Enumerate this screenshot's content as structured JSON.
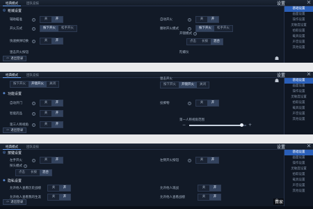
{
  "tabs": [
    "经典模式",
    "团队竞技"
  ],
  "settings_title": "设置",
  "rail": {
    "p1": [
      "基础设置",
      "画面设置",
      "操作设置",
      "灵敏度设置",
      "拾取设置",
      "载具设置",
      "声音设置",
      "其他设置"
    ],
    "p2": [
      "基础设置",
      "画面设置",
      "操作设置",
      "灵敏度设置",
      "拾取设置",
      "载具设置",
      "声音设置",
      "其他设置"
    ],
    "p3": [
      "基础设置",
      "画面设置",
      "操作设置",
      "灵敏度设置",
      "拾取设置",
      "载具设置",
      "声音设置",
      "其他设置"
    ]
  },
  "panel1": {
    "section": "枪械设置",
    "rows": [
      {
        "label": "辅助瞄准",
        "options": [
          "关",
          "开"
        ],
        "selected": 1
      },
      {
        "label": "自动开火",
        "options": [
          "关",
          "开"
        ],
        "selected": 1
      },
      {
        "label": "开火方式",
        "options": [
          "按下开火",
          "松手开火"
        ],
        "selected": 0
      },
      {
        "label": "腰射开火模式",
        "options": [
          "按下开火",
          "松手开火"
        ],
        "selected": 0
      },
      {
        "label": "快速换弹切换",
        "options": [
          "关",
          "开"
        ],
        "selected": 1
      },
      {
        "label": "开镜模式",
        "options": [
          "点击",
          "长按",
          "混合"
        ],
        "selected": 2
      }
    ],
    "truncated_left": "狙击开火按钮",
    "truncated_right": "陀螺仪"
  },
  "panel2": {
    "top_left_options": [
      "按下开火",
      "开镜开火",
      "关闭"
    ],
    "top_right_options": [
      "按下开火",
      "开镜开火",
      "关闭"
    ],
    "top_right_label": "狙击开火",
    "section": "功能设置",
    "rows": [
      {
        "label": "自动开门",
        "options": [
          "关",
          "开"
        ],
        "selected": 1
      },
      {
        "label": "投掷物",
        "options": [
          "关",
          "开"
        ],
        "selected": 1
      },
      {
        "label": "智能药品",
        "options": [
          "关",
          "开"
        ],
        "selected": 1
      },
      {
        "label": "第三人称视角",
        "options": [
          "关",
          "开"
        ],
        "selected": 1
      }
    ],
    "slider_label": "第一人称视角范围",
    "slider_value": 0.92
  },
  "panel3": {
    "section1": "按键设置",
    "row_a": {
      "label": "左手开火",
      "options": [
        "关",
        "开"
      ],
      "selected": 1
    },
    "row_b": {
      "label": "左侧开火按钮",
      "options": [
        "关",
        "开"
      ],
      "selected": 1
    },
    "row_c": {
      "label": "探头模式",
      "options": [
        "点击",
        "长按",
        "混合"
      ],
      "selected": 2
    },
    "section2": "隐私设置",
    "row_d": {
      "label": "允许他人查看历史战绩",
      "options": [
        "关",
        "开"
      ],
      "selected": 1
    },
    "row_e": {
      "label": "允许他人观战",
      "options": [
        "关",
        "开"
      ],
      "selected": 1
    },
    "row_f": {
      "label": "允许他人查看我的生涯",
      "options": [
        "关",
        "开"
      ],
      "selected": 1
    },
    "row_g": {
      "label": "允许他人查看战绩",
      "options": [
        "关",
        "开"
      ],
      "selected": 1
    }
  },
  "exit_label": "退出登录",
  "watermark": "百家号/CG玩手游"
}
